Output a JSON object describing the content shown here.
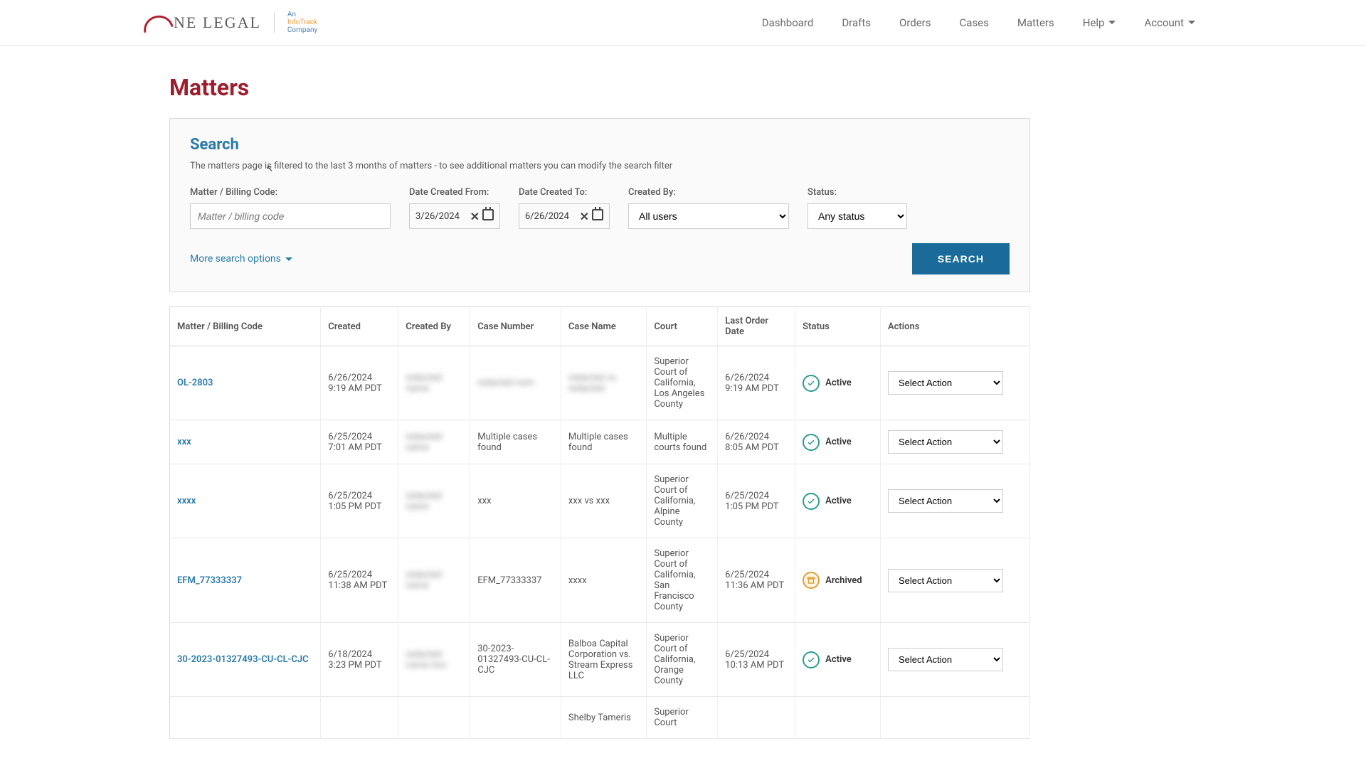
{
  "nav": {
    "dashboard": "Dashboard",
    "drafts": "Drafts",
    "orders": "Orders",
    "cases": "Cases",
    "matters": "Matters",
    "help": "Help",
    "account": "Account"
  },
  "brand": {
    "one_legal": "NE LEGAL",
    "infotrack_line1": "An",
    "infotrack_line2": "InfoTrack",
    "infotrack_line3": "Company"
  },
  "page": {
    "title": "Matters"
  },
  "search": {
    "title": "Search",
    "desc": "The matters page is filtered to the last 3 months of matters - to see additional matters you can modify the search filter",
    "matter_label": "Matter / Billing Code:",
    "matter_placeholder": "Matter / billing code",
    "date_from_label": "Date Created From:",
    "date_from_value": "3/26/2024",
    "date_to_label": "Date Created To:",
    "date_to_value": "6/26/2024",
    "created_by_label": "Created By:",
    "created_by_value": "All users",
    "status_label": "Status:",
    "status_value": "Any status",
    "more_options": "More search options",
    "button": "SEARCH"
  },
  "table": {
    "headers": {
      "matter": "Matter / Billing Code",
      "created": "Created",
      "created_by": "Created By",
      "case_number": "Case Number",
      "case_name": "Case Name",
      "court": "Court",
      "last_order": "Last Order Date",
      "status": "Status",
      "actions": "Actions"
    },
    "action_placeholder": "Select Action",
    "rows": [
      {
        "matter": "OL-2803",
        "created": "6/26/2024 9:19 AM PDT",
        "created_by_blur": "redacted name",
        "case_number_blur": "redacted num",
        "case_name_blur": "redacted vs redacted",
        "court": "Superior Court of California, Los Angeles County",
        "last_order": "6/26/2024 9:19 AM PDT",
        "status": "Active"
      },
      {
        "matter": "xxx",
        "created": "6/25/2024 7:01 AM PDT",
        "created_by_blur": "redacted name",
        "case_number": "Multiple cases found",
        "case_name": "Multiple cases found",
        "court": "Multiple courts found",
        "last_order": "6/26/2024 8:05 AM PDT",
        "status": "Active"
      },
      {
        "matter": "xxxx",
        "created": "6/25/2024 1:05 PM PDT",
        "created_by_blur": "redacted name",
        "case_number": "xxx",
        "case_name": "xxx vs xxx",
        "court": "Superior Court of California, Alpine County",
        "last_order": "6/25/2024 1:05 PM PDT",
        "status": "Active"
      },
      {
        "matter": "EFM_77333337",
        "created": "6/25/2024 11:38 AM PDT",
        "created_by_blur": "redacted name",
        "case_number": "EFM_77333337",
        "case_name": "xxxx",
        "court": "Superior Court of California, San Francisco County",
        "last_order": "6/25/2024 11:36 AM PDT",
        "status": "Archived"
      },
      {
        "matter": "30-2023-01327493-CU-CL-CJC",
        "created": "6/18/2024 3:23 PM PDT",
        "created_by_blur": "redacted name two",
        "case_number": "30-2023-01327493-CU-CL-CJC",
        "case_name": "Balboa Capital Corporation vs. Stream Express LLC",
        "court": "Superior Court of California, Orange County",
        "last_order": "6/25/2024 10:13 AM PDT",
        "status": "Active"
      },
      {
        "matter": "",
        "created": "",
        "created_by_blur": "",
        "case_number": "",
        "case_name": "Shelby Tameris",
        "court": "Superior Court",
        "last_order": "",
        "status": ""
      }
    ]
  }
}
